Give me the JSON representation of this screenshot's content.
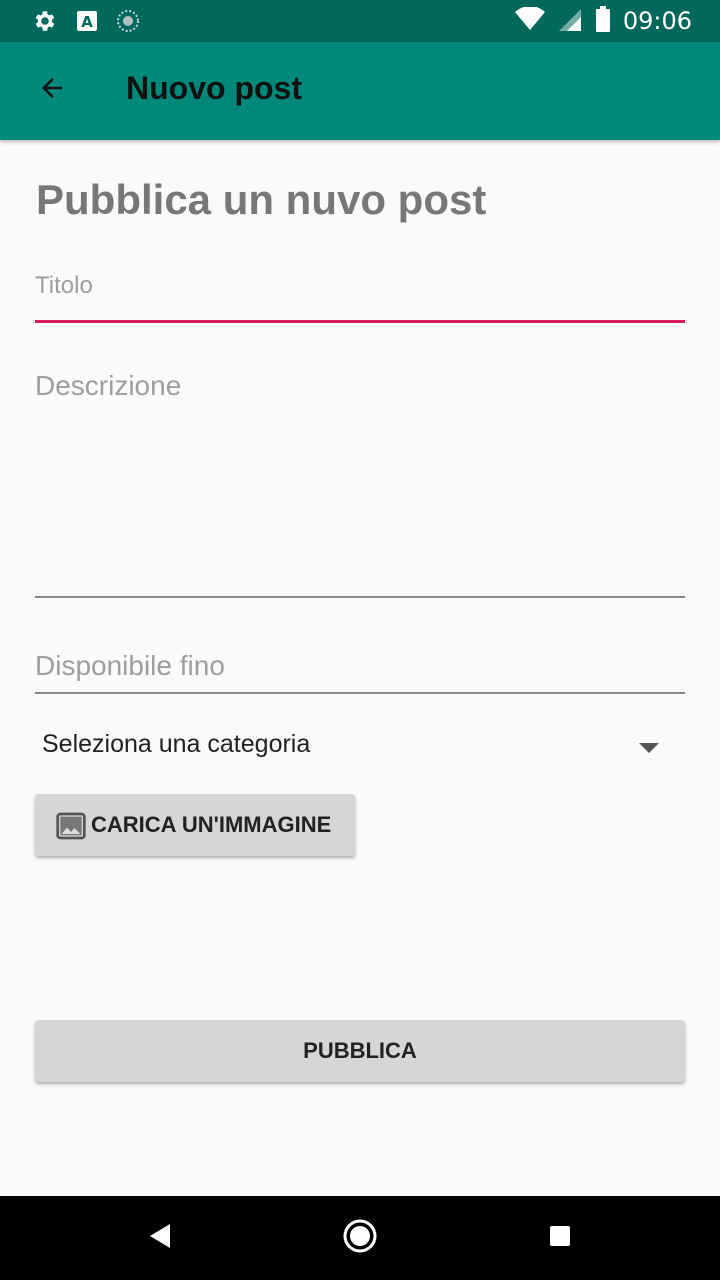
{
  "status_bar": {
    "time": "09:06",
    "left_icons": [
      "settings-icon",
      "font-icon",
      "sync-icon"
    ],
    "right_icons": [
      "wifi-icon",
      "signal-icon",
      "battery-icon"
    ]
  },
  "app_bar": {
    "title": "Nuovo post",
    "back_icon": "arrow-back-icon",
    "color": "#00897b"
  },
  "form": {
    "heading": "Pubblica un nuvo post",
    "title_placeholder": "Titolo",
    "description_placeholder": "Descrizione",
    "available_until_placeholder": "Disponibile fino",
    "category_selected": "Seleziona una categoria",
    "upload_label": "CARICA UN'IMMAGINE",
    "upload_icon": "image-icon",
    "publish_label": "PUBBLICA",
    "accent_color": "#d81b60"
  },
  "nav_bar": {
    "items": [
      "back-triangle-icon",
      "home-circle-icon",
      "recents-square-icon"
    ]
  }
}
